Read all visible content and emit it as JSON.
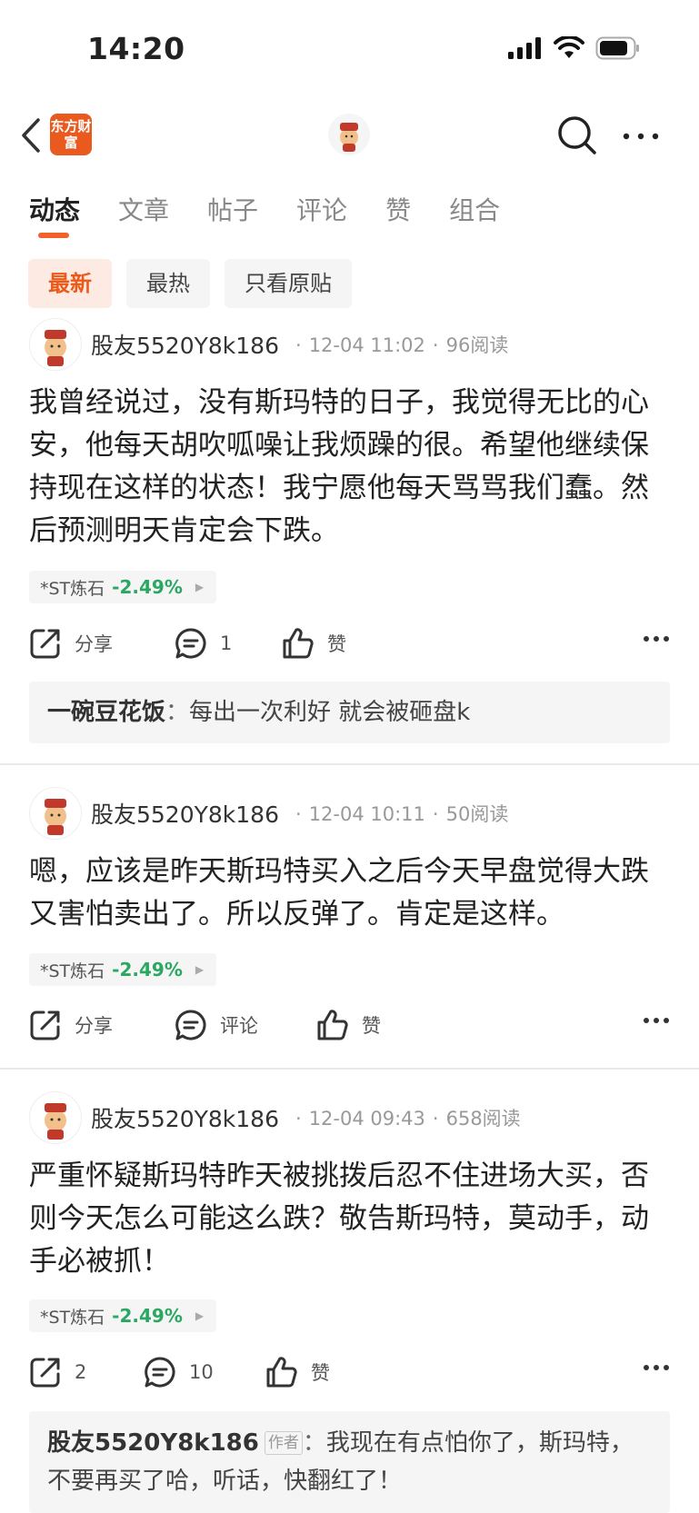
{
  "status_bar": {
    "time": "14:20"
  },
  "nav": {
    "logo_text": "东方财富"
  },
  "tabs": [
    {
      "label": "动态",
      "active": true
    },
    {
      "label": "文章",
      "active": false
    },
    {
      "label": "帖子",
      "active": false
    },
    {
      "label": "评论",
      "active": false
    },
    {
      "label": "赞",
      "active": false
    },
    {
      "label": "组合",
      "active": false
    }
  ],
  "filters": [
    {
      "label": "最新",
      "active": true
    },
    {
      "label": "最热",
      "active": false
    },
    {
      "label": "只看原贴",
      "active": false
    }
  ],
  "colors": {
    "accent": "#ec5a1b",
    "stock_up_green": "#2aa863"
  },
  "posts": [
    {
      "author": "股友5520Y8k186",
      "time": "12-04 11:02",
      "reads": "96阅读",
      "body": "我曾经说过，没有斯玛特的日子，我觉得无比的心安，他每天胡吹呱噪让我烦躁的很。希望他继续保持现在这样的状态！我宁愿他每天骂骂我们蠢。然后预测明天肯定会下跌。",
      "stock_name": "*ST炼石",
      "stock_change": "-2.49%",
      "share_label": "分享",
      "comment_label": "1",
      "like_label": "赞",
      "reply": {
        "name": "一碗豆花饭",
        "sep": "：",
        "text": "每出一次利好 就会被砸盘k"
      }
    },
    {
      "author": "股友5520Y8k186",
      "time": "12-04 10:11",
      "reads": "50阅读",
      "body": "嗯，应该是昨天斯玛特买入之后今天早盘觉得大跌又害怕卖出了。所以反弹了。肯定是这样。",
      "stock_name": "*ST炼石",
      "stock_change": "-2.49%",
      "share_label": "分享",
      "comment_label": "评论",
      "like_label": "赞"
    },
    {
      "author": "股友5520Y8k186",
      "time": "12-04 09:43",
      "reads": "658阅读",
      "body": "严重怀疑斯玛特昨天被挑拨后忍不住进场大买，否则今天怎么可能这么跌？敬告斯玛特，莫动手，动手必被抓！",
      "stock_name": "*ST炼石",
      "stock_change": "-2.49%",
      "share_label": "2",
      "comment_label": "10",
      "like_label": "赞",
      "reply": {
        "name": "股友5520Y8k186",
        "author_tag": "作者",
        "sep": "：",
        "text": "我现在有点怕你了，斯玛特，不要再买了哈，听话，快翻红了！"
      }
    }
  ]
}
